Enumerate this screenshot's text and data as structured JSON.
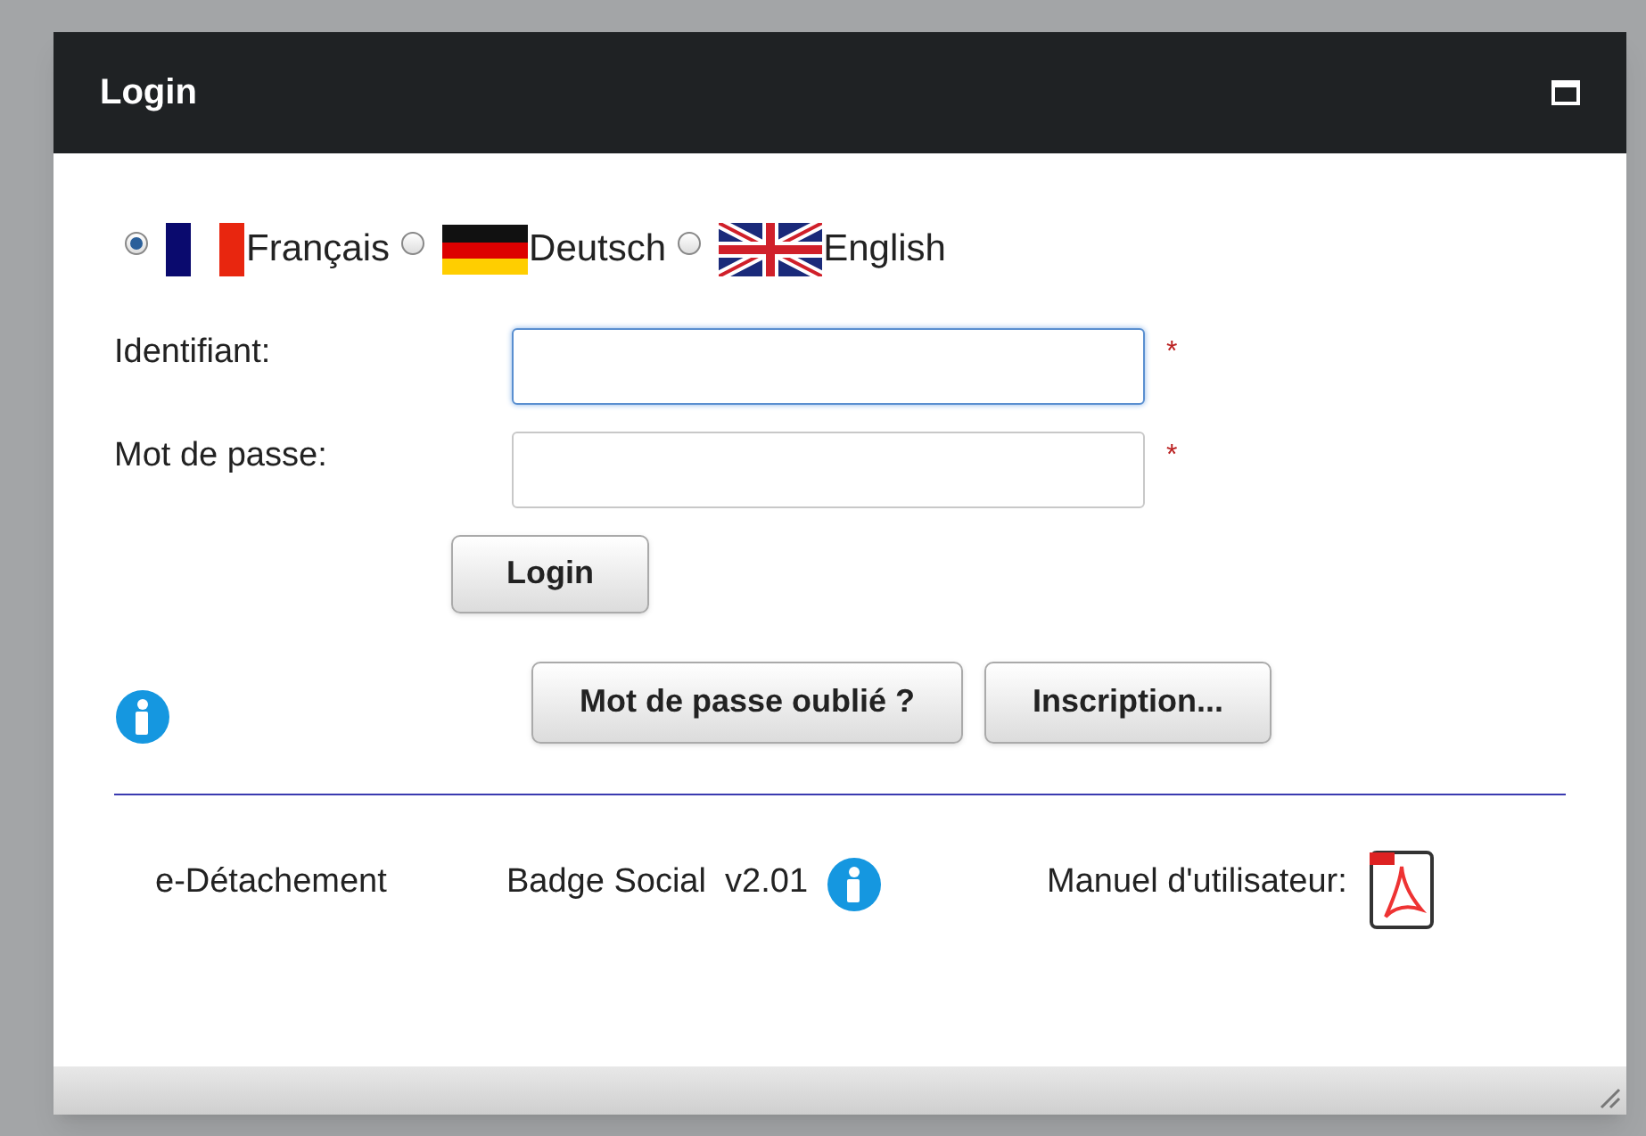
{
  "window": {
    "title": "Login"
  },
  "languages": [
    {
      "label": "Français",
      "selected": true
    },
    {
      "label": "Deutsch",
      "selected": false
    },
    {
      "label": "English",
      "selected": false
    }
  ],
  "fields": [
    {
      "label": "Identifiant:",
      "required": "*",
      "focused": true
    },
    {
      "label": "Mot de passe:",
      "required": "*",
      "focused": false
    }
  ],
  "login_button": "Login",
  "buttons": [
    "Mot de passe oublié ?",
    "Inscription..."
  ],
  "footer": {
    "app": "e-Détachement",
    "product": "Badge Social  v2.01",
    "manual": "Manuel d'utilisateur:"
  }
}
